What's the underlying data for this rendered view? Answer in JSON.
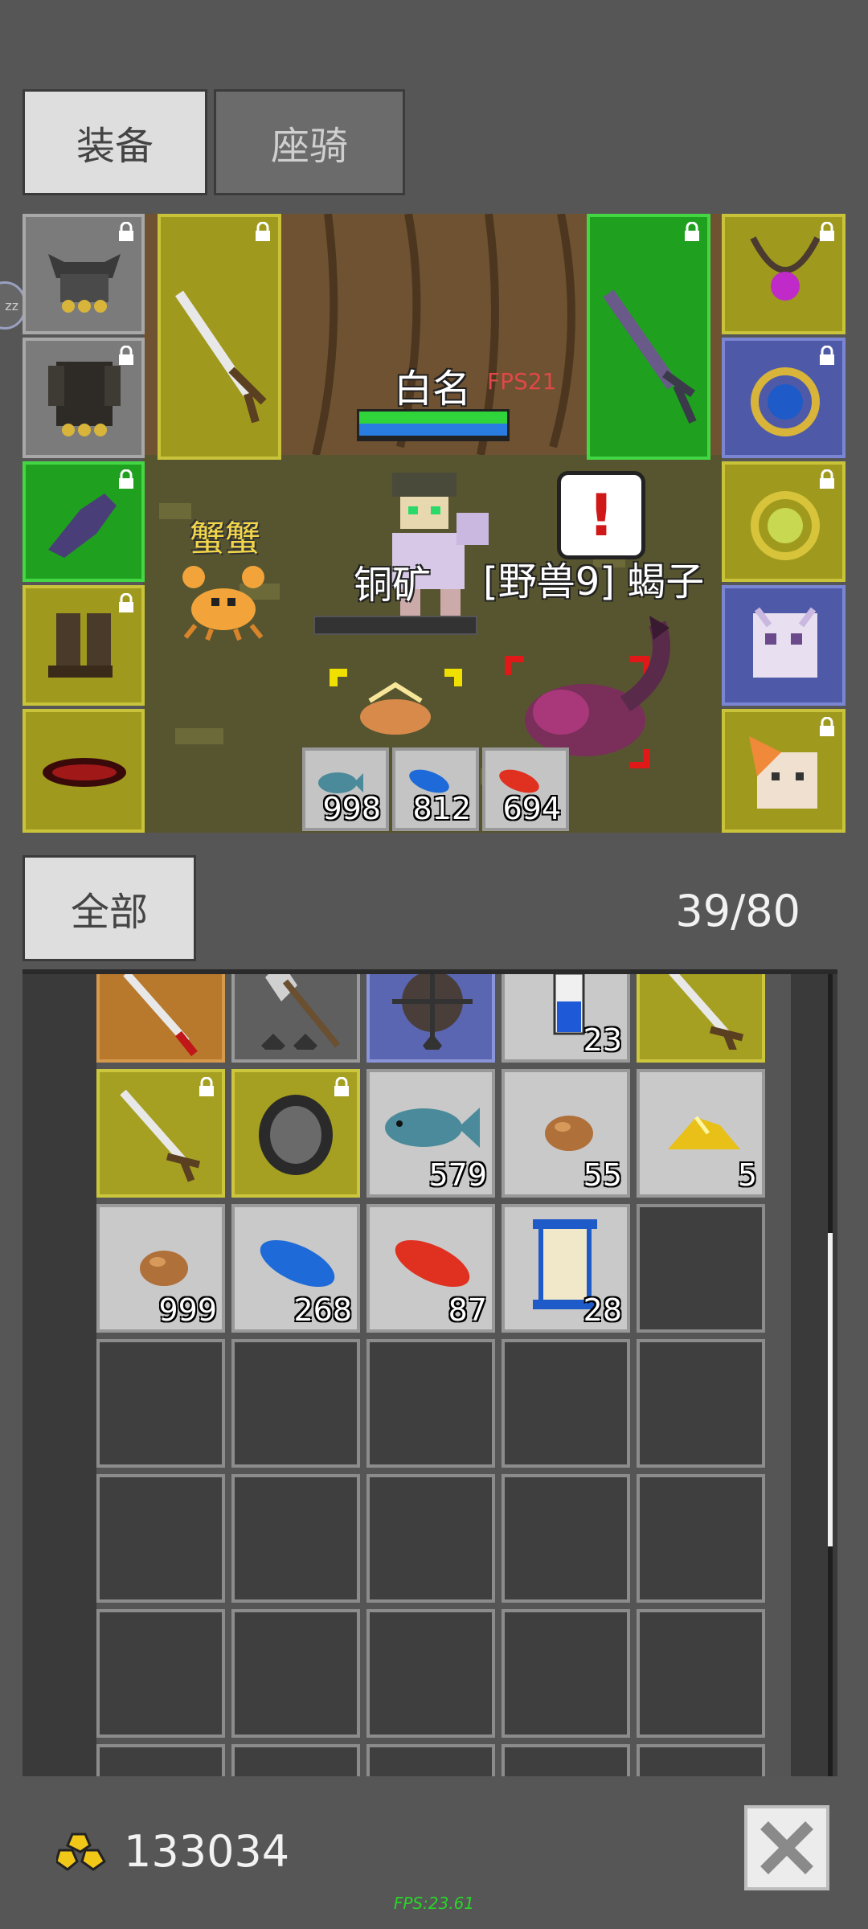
{
  "tabs": [
    {
      "label": "装备"
    },
    {
      "label": "座骑"
    }
  ],
  "scene": {
    "player_name": "白名",
    "fps_tag": "FPS21",
    "npc_crab": "蟹蟹",
    "ore_label": "铜矿",
    "enemy_label": "[野兽9] 蝎子",
    "resources": [
      {
        "icon": "fish-icon",
        "count": "998"
      },
      {
        "icon": "blue-feather-icon",
        "count": "812"
      },
      {
        "icon": "red-feather-icon",
        "count": "694"
      }
    ]
  },
  "equipment": {
    "left": [
      "helmet-icon",
      "armor-icon",
      "glove-icon",
      "boots-icon",
      "belt-icon"
    ],
    "right": [
      "necklace-icon",
      "blue-ring-icon",
      "gold-ring-icon",
      "pet-portrait-icon",
      "mount-portrait-icon"
    ],
    "weapon_main": "sword-icon",
    "weapon_off": "dagger-icon"
  },
  "filter": {
    "label": "全部",
    "capacity": "39/80"
  },
  "inventory": {
    "row0": [
      {
        "icon": "red-sword-icon",
        "count": ""
      },
      {
        "icon": "axe-icon",
        "count": ""
      },
      {
        "icon": "spiked-mace-icon",
        "count": ""
      },
      {
        "icon": "blue-potion-icon",
        "count": "23"
      },
      {
        "icon": "sword-icon",
        "count": ""
      }
    ],
    "row1": [
      {
        "icon": "sword-icon",
        "count": ""
      },
      {
        "icon": "shield-icon",
        "count": ""
      },
      {
        "icon": "fish-icon",
        "count": "579"
      },
      {
        "icon": "ore-icon",
        "count": "55"
      },
      {
        "icon": "gold-pile-icon",
        "count": "5"
      }
    ],
    "row2": [
      {
        "icon": "ore-icon",
        "count": "999"
      },
      {
        "icon": "blue-feather-icon",
        "count": "268"
      },
      {
        "icon": "red-feather-icon",
        "count": "87"
      },
      {
        "icon": "scroll-icon",
        "count": "28"
      }
    ]
  },
  "gold": "133034",
  "fps_footer": "FPS:23.61"
}
